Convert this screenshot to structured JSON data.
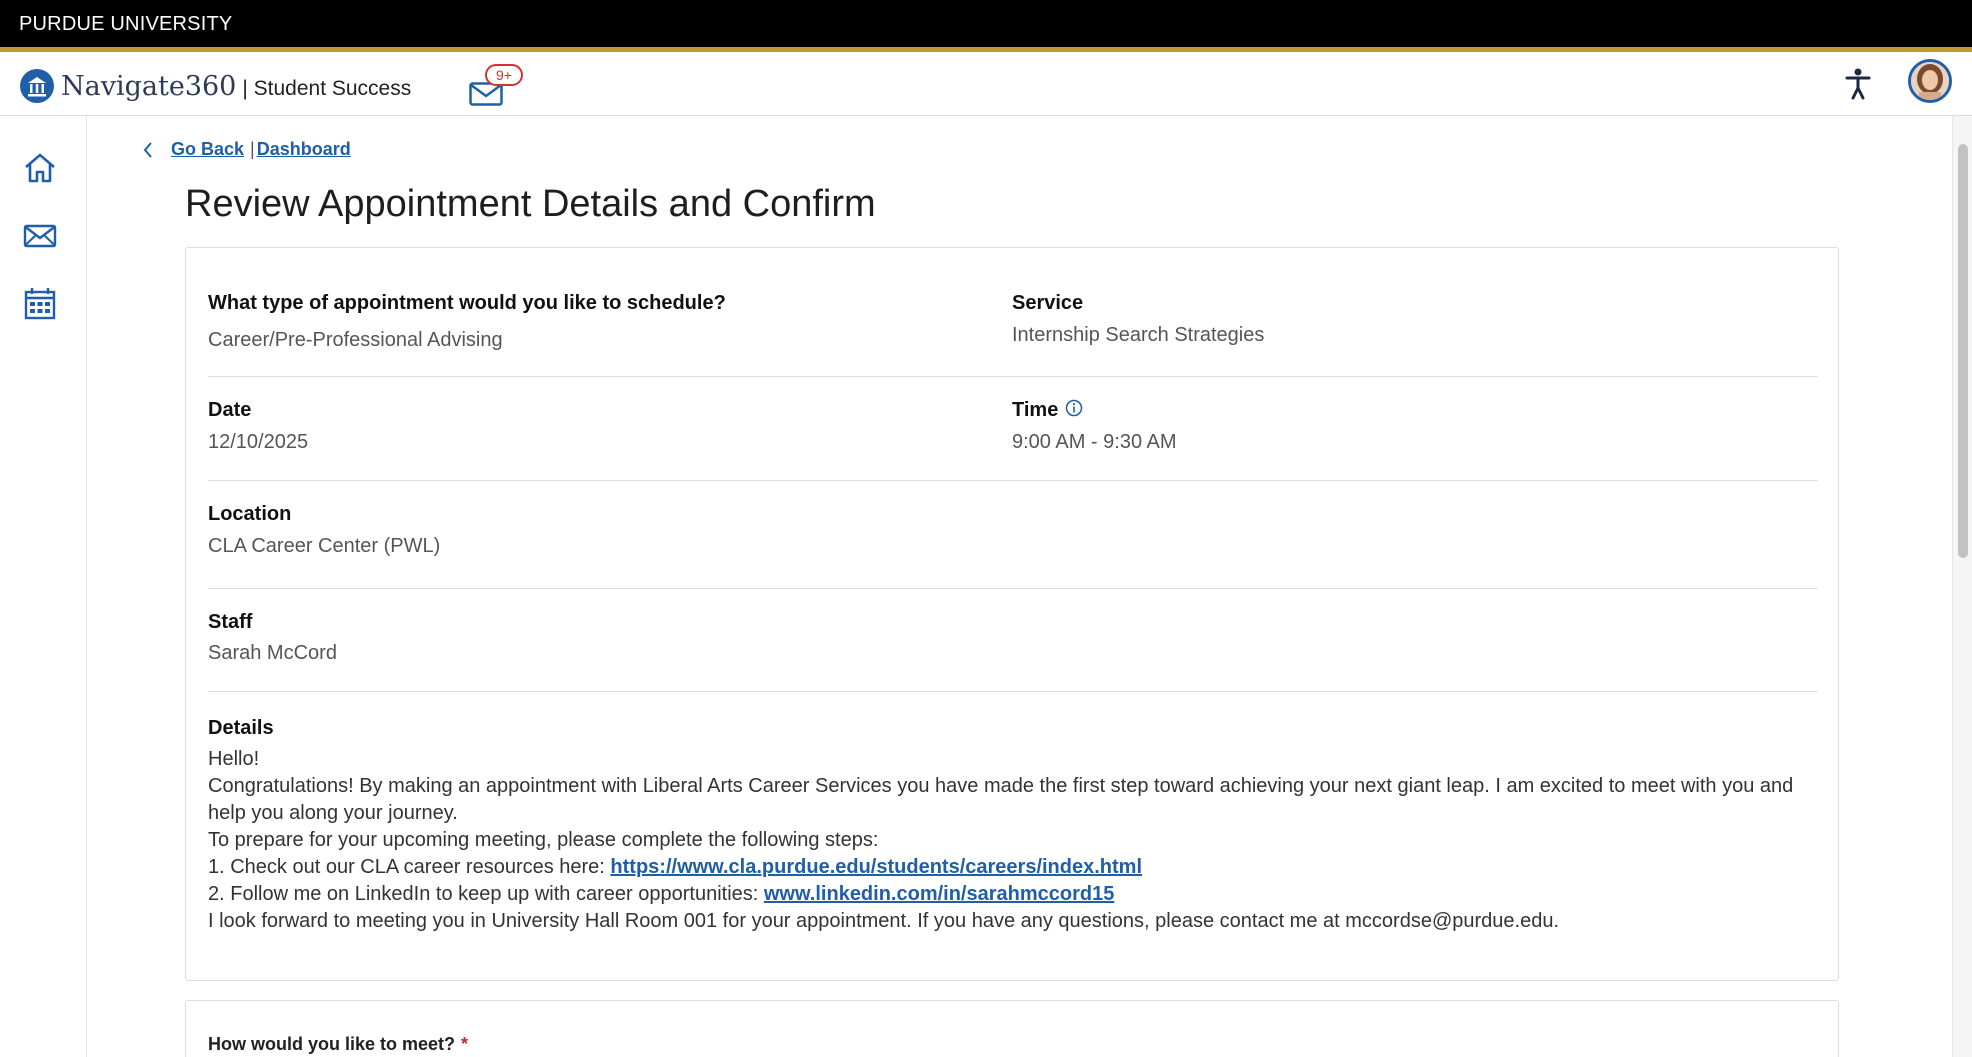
{
  "topbar": {
    "university": "PURDUE UNIVERSITY"
  },
  "header": {
    "app_name": "Navigate360",
    "app_sub": "| Student Success",
    "mail_badge": "9+"
  },
  "breadcrumb": {
    "back": "Go Back",
    "separator": "|",
    "dashboard": "Dashboard"
  },
  "page": {
    "title": "Review Appointment Details and Confirm"
  },
  "appointment": {
    "type_label": "What type of appointment would you like to schedule?",
    "type_value": "Career/Pre-Professional Advising",
    "service_label": "Service",
    "service_value": "Internship Search Strategies",
    "date_label": "Date",
    "date_value": "12/10/2025",
    "time_label": "Time",
    "time_value": "9:00 AM - 9:30 AM",
    "location_label": "Location",
    "location_value": "CLA Career Center (PWL)",
    "staff_label": "Staff",
    "staff_value": "Sarah McCord",
    "details_label": "Details",
    "details": {
      "line1": "Hello!",
      "line2": "Congratulations! By making an appointment with Liberal Arts Career Services you have made the first step toward achieving your next giant leap. I am excited to meet with you and help you along your journey.",
      "line3": "To prepare for your upcoming meeting, please complete the following steps:",
      "step1_text": "1. Check out our CLA career resources here: ",
      "step1_link": "https://www.cla.purdue.edu/students/careers/index.html",
      "step2_text": "2. Follow me on LinkedIn to keep up with career opportunities: ",
      "step2_link": "www.linkedin.com/in/sarahmccord15",
      "line4": "I look forward to meeting you in University Hall Room 001 for your appointment. If you have any questions, please contact me at mccordse@purdue.edu."
    }
  },
  "meeting": {
    "label": "How would you like to meet?",
    "required_mark": "*"
  },
  "colors": {
    "brand_blue": "#1f5ea8",
    "gold": "#c19a2c",
    "required_red": "#c62828"
  },
  "icons": [
    "home-icon",
    "mail-icon",
    "calendar-icon",
    "accessibility-icon",
    "info-icon",
    "chevron-left-icon"
  ]
}
